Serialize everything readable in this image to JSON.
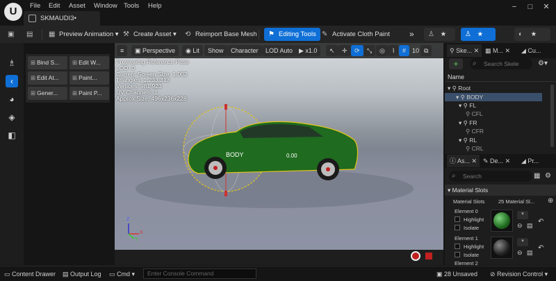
{
  "app": {
    "logo": "U",
    "menus": [
      "File",
      "Edit",
      "Asset",
      "Window",
      "Tools",
      "Help"
    ],
    "document_tab": "SKMAUDI3•"
  },
  "toolbar": {
    "preview_animation": "Preview Animation",
    "create_asset": "Create Asset",
    "reimport": "Reimport Base Mesh",
    "editing_tools": "Editing Tools",
    "activate_cloth": "Activate Cloth Paint"
  },
  "tool_panel": {
    "bind": "Bind S...",
    "edit_w": "Edit W...",
    "edit_at": "Edit At...",
    "paint1": "Paint...",
    "gener": "Gener...",
    "paint_p": "Paint P..."
  },
  "viewport": {
    "perspective": "Perspective",
    "lit": "Lit",
    "show": "Show",
    "character": "Character",
    "lod": "LOD Auto",
    "speed": "x1.0",
    "grid_value": "10",
    "stats": [
      "Previewing Reference Pose",
      "LOD: 0",
      "Current Screen Size: 1.002",
      "Triangles: 1,233,313",
      "Vertices: 981,923",
      "UV Channels: 1",
      "Approx Size: 496x236x228"
    ],
    "body_label": "BODY",
    "rotation_value": "0.00",
    "axis_x": "X",
    "axis_y": "Y",
    "axis_z": "Z",
    "car_color": "#1f6b1f",
    "gizmo_color": "#e3c619"
  },
  "skeleton_panel": {
    "tabs": [
      "Ske...",
      "M...",
      "Cu..."
    ],
    "search_placeholder": "Search Skele",
    "name_header": "Name",
    "tree": [
      "Root",
      "BODY",
      "FL",
      "CFL",
      "FR",
      "CFR",
      "RL",
      "CRL"
    ]
  },
  "details_panel": {
    "tabs": [
      "As...",
      "De...",
      "Pr..."
    ],
    "search_placeholder": "Search",
    "section": "Material Slots",
    "slots_label": "Material Slots",
    "slots_value": "25 Material Sl...",
    "elements": [
      {
        "name": "Element 0",
        "highlight": "Highlight",
        "isolate": "Isolate"
      },
      {
        "name": "Element 1",
        "highlight": "Highlight",
        "isolate": "Isolate"
      },
      {
        "name": "Element 2"
      }
    ]
  },
  "statusbar": {
    "content_drawer": "Content Drawer",
    "output_log": "Output Log",
    "cmd": "Cmd",
    "console_placeholder": "Enter Console Command",
    "unsaved": "28 Unsaved",
    "revision": "Revision Control"
  }
}
